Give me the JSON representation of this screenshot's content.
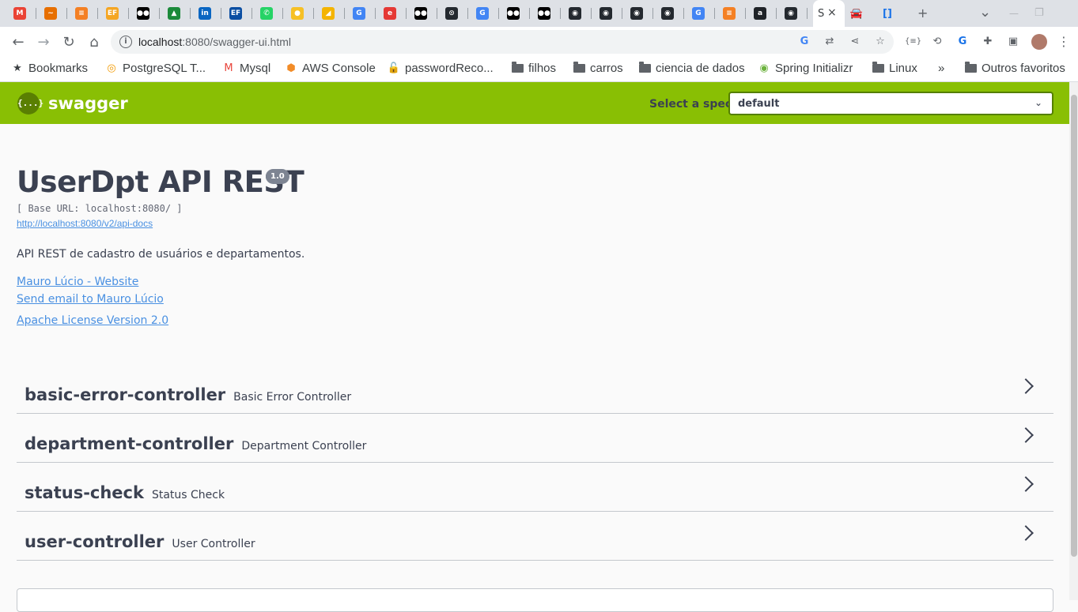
{
  "browser": {
    "active_tab_title": "S",
    "url_host": "localhost",
    "url_path": ":8080/swagger-ui.html",
    "tab_favicons": [
      {
        "name": "gmail",
        "color": "#ea4335",
        "glyph": "M"
      },
      {
        "name": "java",
        "color": "#e76f00",
        "glyph": "~"
      },
      {
        "name": "stackoverflow",
        "color": "#f48024",
        "glyph": "≡"
      },
      {
        "name": "ef",
        "color": "#f5a623",
        "glyph": "EF"
      },
      {
        "name": "medium",
        "color": "#000000",
        "glyph": "●●"
      },
      {
        "name": "app",
        "color": "#1b8a3a",
        "glyph": "▲"
      },
      {
        "name": "linkedin",
        "color": "#0a66c2",
        "glyph": "in"
      },
      {
        "name": "ef-italic",
        "color": "#0b4ea2",
        "glyph": "EF"
      },
      {
        "name": "whatsapp",
        "color": "#25d366",
        "glyph": "✆"
      },
      {
        "name": "yellow",
        "color": "#f6c026",
        "glyph": "●"
      },
      {
        "name": "drive",
        "color": "#f4b400",
        "glyph": "◢"
      },
      {
        "name": "google",
        "color": "#4285f4",
        "glyph": "G"
      },
      {
        "name": "red-app",
        "color": "#e53935",
        "glyph": "e"
      },
      {
        "name": "medium",
        "color": "#000000",
        "glyph": "●●"
      },
      {
        "name": "github-copilot",
        "color": "#24292f",
        "glyph": "⊙"
      },
      {
        "name": "google",
        "color": "#4285f4",
        "glyph": "G"
      },
      {
        "name": "medium",
        "color": "#000000",
        "glyph": "●●"
      },
      {
        "name": "medium",
        "color": "#000000",
        "glyph": "●●"
      },
      {
        "name": "github",
        "color": "#24292f",
        "glyph": "◉"
      },
      {
        "name": "github",
        "color": "#24292f",
        "glyph": "◉"
      },
      {
        "name": "github",
        "color": "#24292f",
        "glyph": "◉"
      },
      {
        "name": "github",
        "color": "#24292f",
        "glyph": "◉"
      },
      {
        "name": "google",
        "color": "#4285f4",
        "glyph": "G"
      },
      {
        "name": "stackoverflow",
        "color": "#f48024",
        "glyph": "≡"
      },
      {
        "name": "app-a",
        "color": "#1f2328",
        "glyph": "a"
      },
      {
        "name": "github",
        "color": "#24292f",
        "glyph": "◉"
      }
    ],
    "after_tabs": [
      {
        "name": "car",
        "color": "#1a73e8",
        "glyph": "🚘"
      },
      {
        "name": "bracket-app",
        "color": "#1a73e8",
        "glyph": "[]"
      }
    ],
    "new_tab": "+",
    "window_controls": {
      "list": "⌄",
      "minimize": "—",
      "restore": "❐"
    }
  },
  "bookmarks": [
    {
      "label": "Bookmarks",
      "icon": "star",
      "glyph": "★",
      "color": "#3c4043"
    },
    {
      "label": "PostgreSQL T...",
      "icon": "postgres",
      "glyph": "◎",
      "color": "#f29900"
    },
    {
      "label": "Mysql",
      "icon": "mysql",
      "glyph": "M",
      "color": "#e8453c"
    },
    {
      "label": "AWS Console",
      "icon": "aws",
      "glyph": "⬢",
      "color": "#f28c28"
    },
    {
      "label": "passwordReco...",
      "icon": "lock",
      "glyph": "🔓",
      "color": "#3c4043"
    },
    {
      "label": "filhos",
      "icon": "folder"
    },
    {
      "label": "carros",
      "icon": "folder"
    },
    {
      "label": "ciencia de dados",
      "icon": "folder"
    },
    {
      "label": "Spring Initializr",
      "icon": "spring",
      "glyph": "◉",
      "color": "#6db33f"
    },
    {
      "label": "Linux",
      "icon": "folder"
    },
    {
      "label": "»",
      "icon": "none"
    },
    {
      "label": "Outros favoritos",
      "icon": "folder"
    }
  ],
  "swagger": {
    "brand": "swagger",
    "logo_glyph": "{...}",
    "spec_label": "Select a spec",
    "spec_value": "default"
  },
  "info": {
    "title": "UserDpt API REST",
    "version": "1.0",
    "base_url": "[ Base URL: localhost:8080/ ]",
    "api_docs_link": "http://localhost:8080/v2/api-docs",
    "description": "API REST de cadastro de usuários e departamentos.",
    "website_link": "Mauro Lúcio - Website",
    "email_link": "Send email to Mauro Lúcio",
    "license_link": "Apache License Version 2.0"
  },
  "controllers": [
    {
      "name": "basic-error-controller",
      "description": "Basic Error Controller"
    },
    {
      "name": "department-controller",
      "description": "Department Controller"
    },
    {
      "name": "status-check",
      "description": "Status Check"
    },
    {
      "name": "user-controller",
      "description": "User Controller"
    }
  ]
}
